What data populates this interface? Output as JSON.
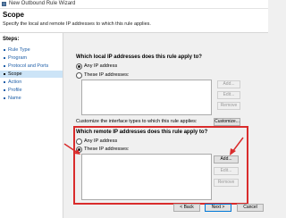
{
  "window": {
    "title": "New Outbound Rule Wizard"
  },
  "header": {
    "title": "Scope",
    "description": "Specify the local and remote IP addresses to which this rule applies."
  },
  "steps": {
    "label": "Steps:",
    "items": [
      {
        "label": "Rule Type",
        "active": false
      },
      {
        "label": "Program",
        "active": false
      },
      {
        "label": "Protocol and Ports",
        "active": false
      },
      {
        "label": "Scope",
        "active": true
      },
      {
        "label": "Action",
        "active": false
      },
      {
        "label": "Profile",
        "active": false
      },
      {
        "label": "Name",
        "active": false
      }
    ]
  },
  "local": {
    "question": "Which local IP addresses does this rule apply to?",
    "option_any": "Any IP address",
    "option_these": "These IP addresses:",
    "selected": "any",
    "buttons": {
      "add": "Add...",
      "edit": "Edit...",
      "remove": "Remove"
    }
  },
  "customize": {
    "text": "Customize the interface types to which this rule applies:",
    "button": "Customize..."
  },
  "remote": {
    "question": "Which remote IP addresses does this rule apply to?",
    "option_any": "Any IP address",
    "option_these": "These IP addresses:",
    "selected": "these",
    "buttons": {
      "add": "Add...",
      "edit": "Edit...",
      "remove": "Remove"
    }
  },
  "footer": {
    "back": "< Back",
    "next": "Next >",
    "cancel": "Cancel"
  },
  "colors": {
    "highlight": "#d92c2c",
    "active_step": "#cce4f7",
    "link": "#1f5fa8"
  }
}
